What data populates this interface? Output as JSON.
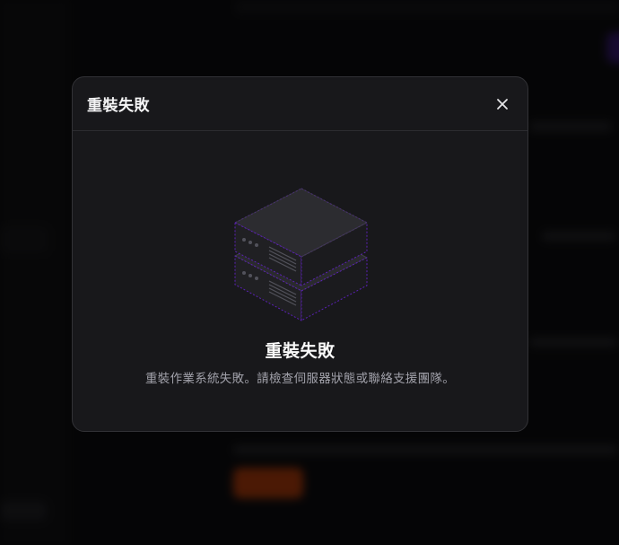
{
  "dialog": {
    "title": "重裝失敗",
    "close_icon": "close-icon",
    "illustration_icon": "server-stack-icon",
    "error_title": "重裝失敗",
    "error_message": "重裝作業系統失敗。請檢查伺服器狀態或聯絡支援團隊。"
  },
  "colors": {
    "accent": "#5b21b6",
    "modal_bg": "#18181b",
    "action_orange": "#c2410c"
  }
}
